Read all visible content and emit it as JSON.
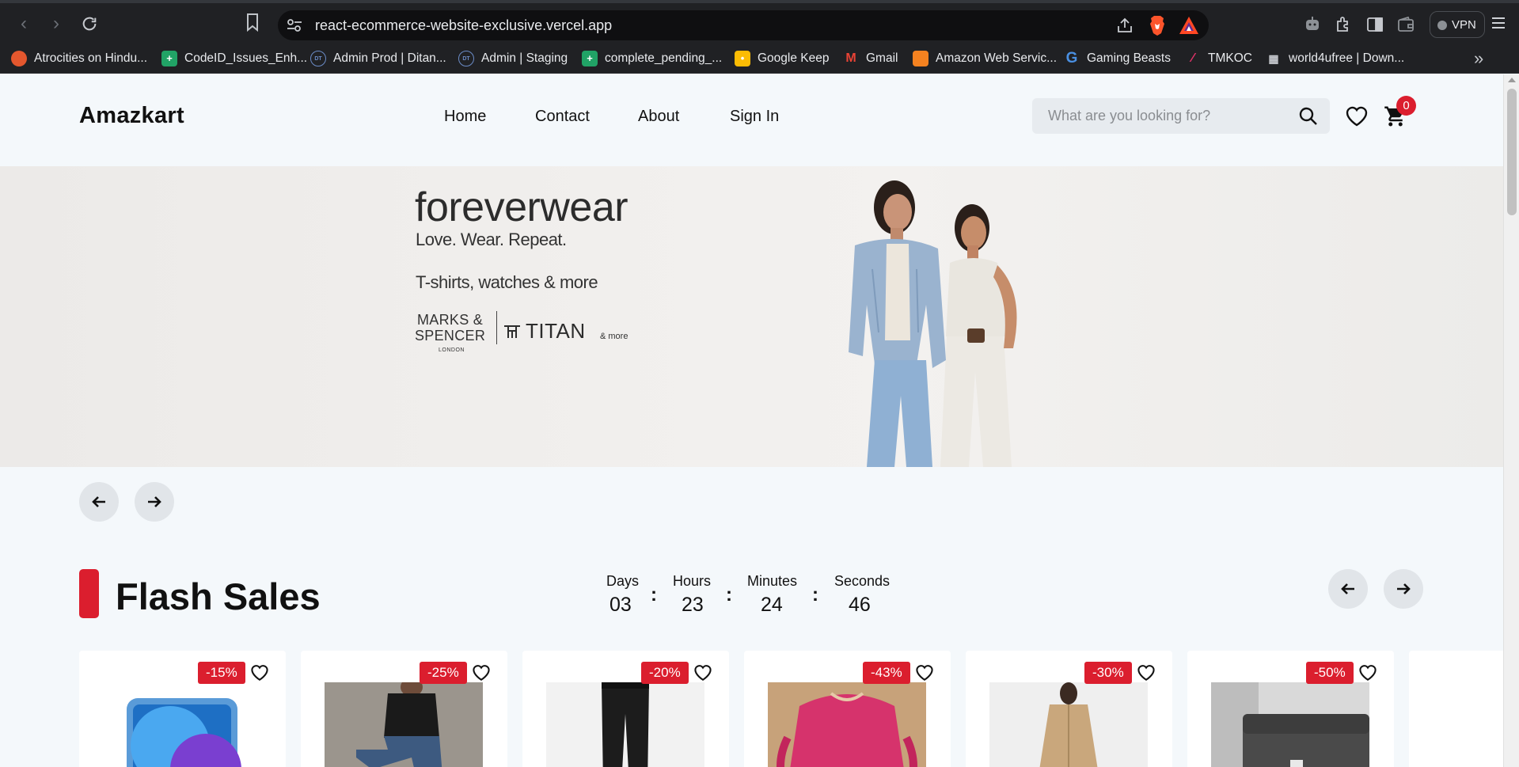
{
  "browser": {
    "url": "react-ecommerce-website-exclusive.vercel.app",
    "vpn_label": "VPN",
    "bookmarks": [
      {
        "label": "Atrocities on Hindu...",
        "icon": "bookmark-favicon-red-icon"
      },
      {
        "label": "CodeID_Issues_Enh...",
        "icon": "sheets-icon"
      },
      {
        "label": "Admin Prod | Ditan...",
        "icon": "ditanzo-icon"
      },
      {
        "label": "Admin | Staging",
        "icon": "ditanzo-icon"
      },
      {
        "label": "complete_pending_...",
        "icon": "sheets-icon"
      },
      {
        "label": "Google Keep",
        "icon": "keep-icon"
      },
      {
        "label": "Gmail",
        "icon": "gmail-icon"
      },
      {
        "label": "Amazon Web Servic...",
        "icon": "aws-icon"
      },
      {
        "label": "Gaming Beasts",
        "icon": "g-icon"
      },
      {
        "label": "TMKOC",
        "icon": "tmkoc-icon"
      },
      {
        "label": "world4ufree | Down...",
        "icon": "film-icon"
      }
    ]
  },
  "header": {
    "logo": "Amazkart",
    "nav": [
      "Home",
      "Contact",
      "About",
      "Sign In"
    ],
    "search_placeholder": "What are you looking for?",
    "cart_count": "0"
  },
  "hero": {
    "brand": "foreverwear",
    "tagline": "Love. Wear. Repeat.",
    "subtitle": "T-shirts, watches & more",
    "partner1_line1": "MARKS &",
    "partner1_line2": "SPENCER",
    "partner1_city": "LONDON",
    "partner2": "TITAN",
    "partner_more": "& more"
  },
  "flash_sales": {
    "title": "Flash Sales",
    "countdown": [
      {
        "label": "Days",
        "value": "03"
      },
      {
        "label": "Hours",
        "value": "23"
      },
      {
        "label": "Minutes",
        "value": "24"
      },
      {
        "label": "Seconds",
        "value": "46"
      }
    ],
    "products": [
      {
        "discount": "-15%",
        "image": "tablet"
      },
      {
        "discount": "-25%",
        "image": "man-jeans"
      },
      {
        "discount": "-20%",
        "image": "track-pants"
      },
      {
        "discount": "-43%",
        "image": "pink-top"
      },
      {
        "discount": "-30%",
        "image": "trench-coat"
      },
      {
        "discount": "-50%",
        "image": "sofa"
      }
    ]
  },
  "colors": {
    "accent": "#db1e2e",
    "page_bg": "#f4f8fb",
    "browser_bg": "#202124"
  }
}
